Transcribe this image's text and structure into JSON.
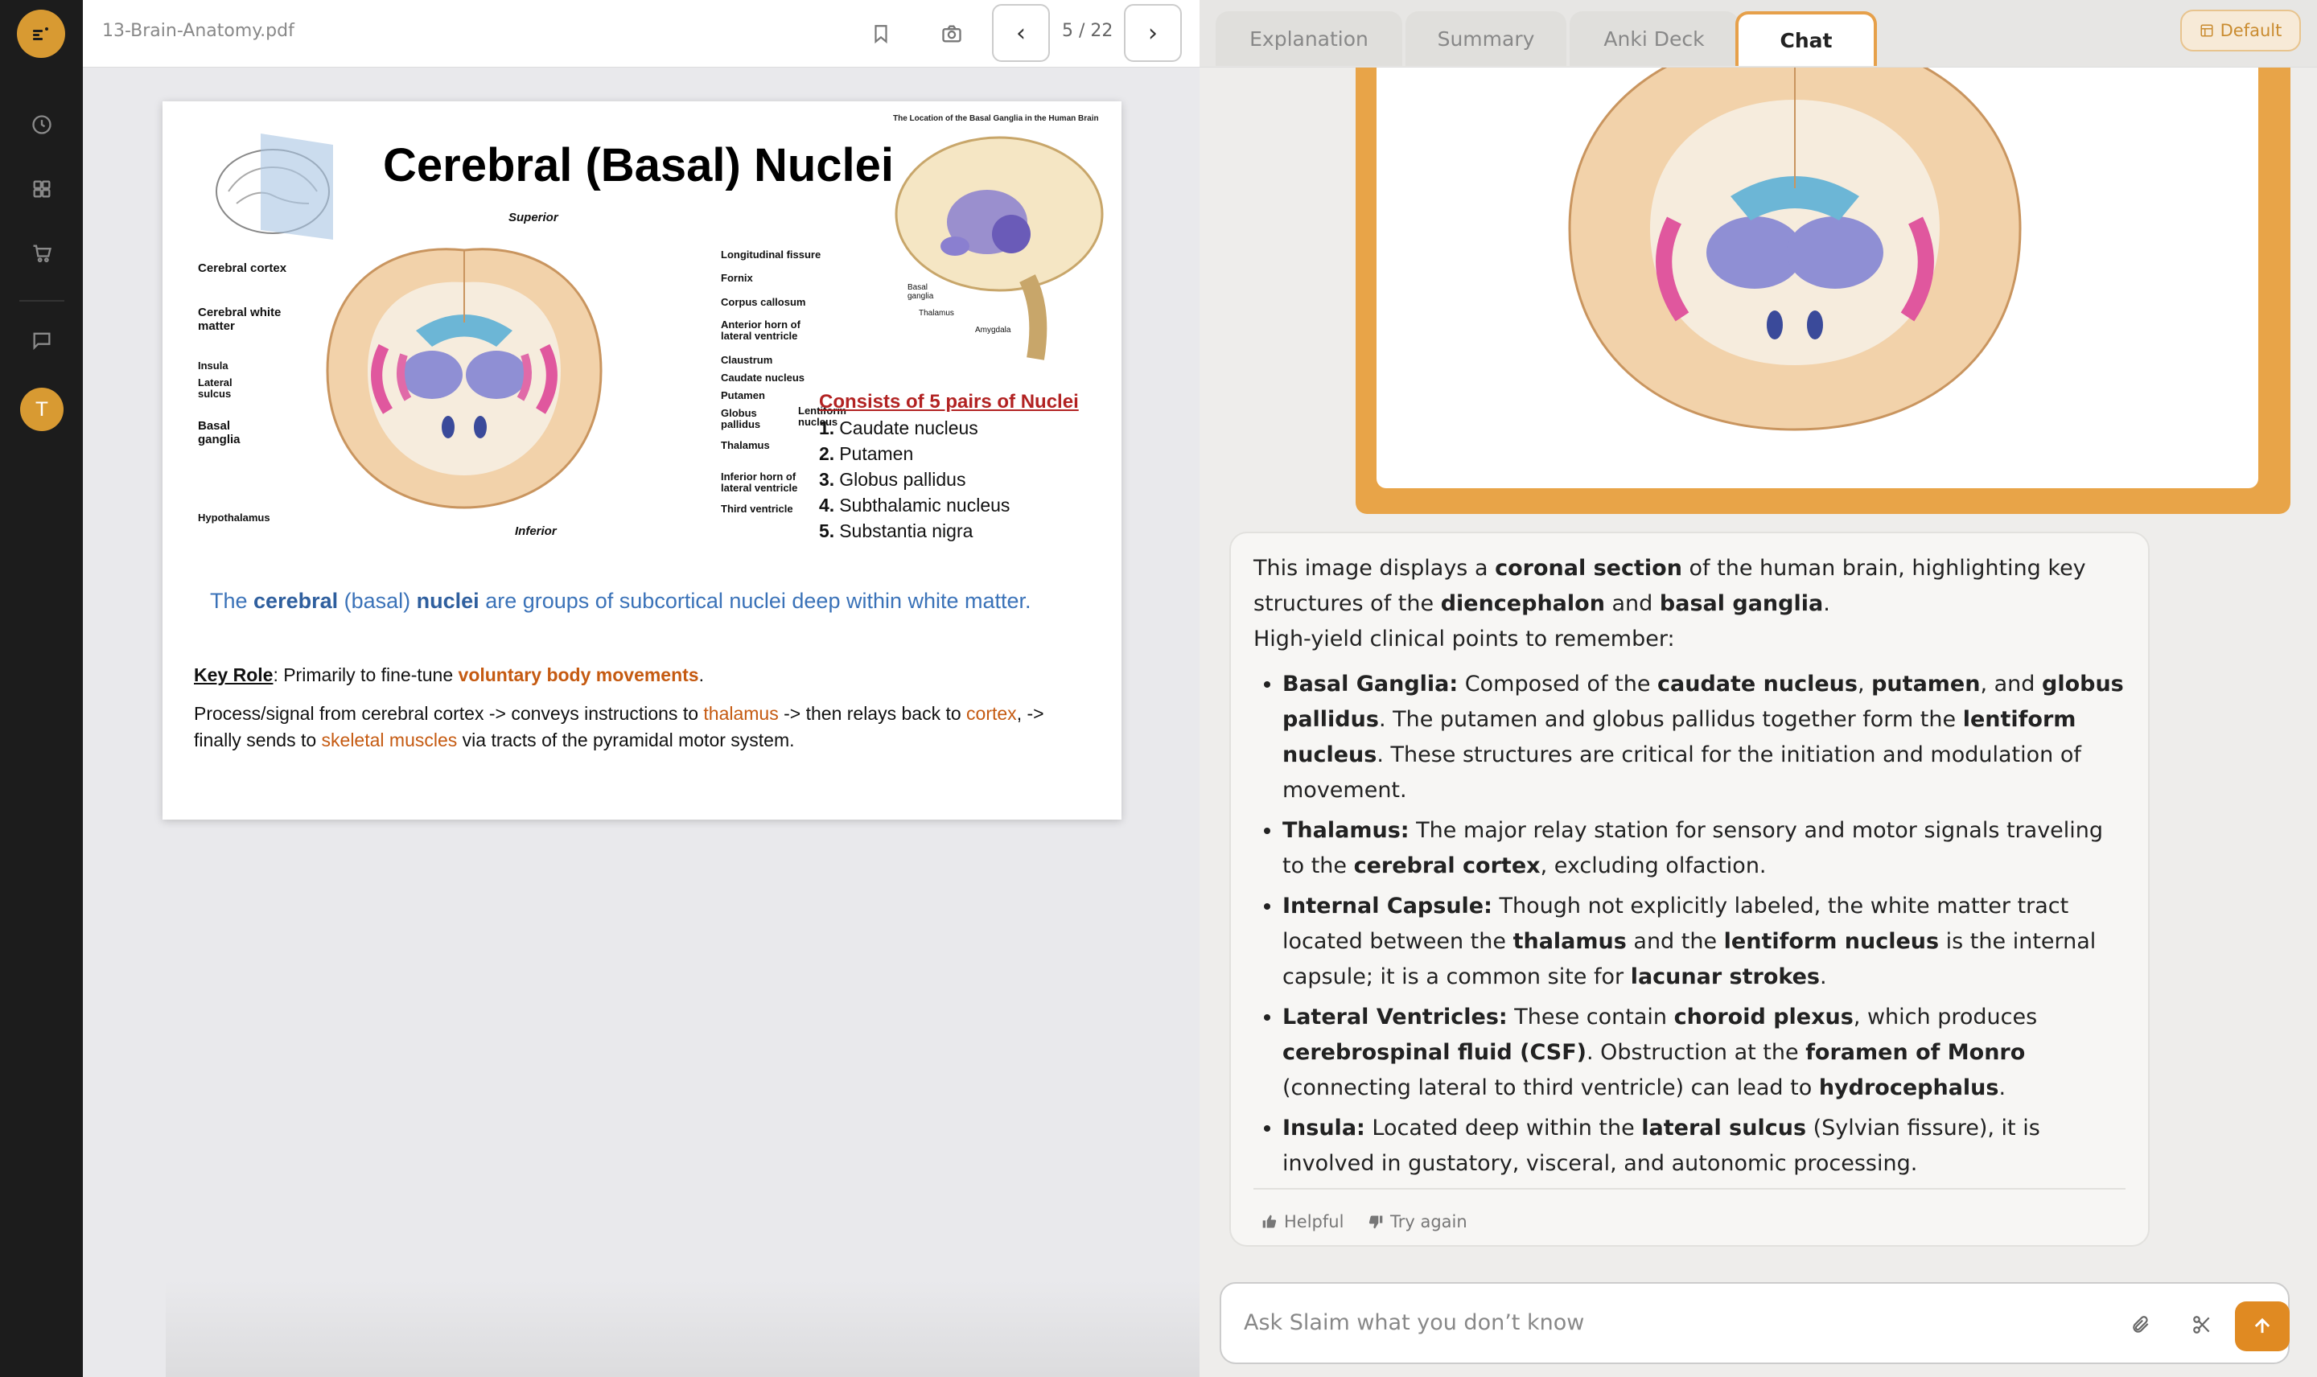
{
  "viewer": {
    "filename": "13-Brain-Anatomy.pdf",
    "page_indicator": "5 / 22"
  },
  "sidebar": {
    "avatar_initial": "T"
  },
  "slide": {
    "title": "Cerebral (Basal) Nuclei",
    "location_caption": "The Location of the Basal Ganglia in the Human Brain",
    "labels": {
      "superior": "Superior",
      "inferior": "Inferior",
      "cerebral_cortex": "Cerebral cortex",
      "cerebral_white_matter": "Cerebral white matter",
      "insula": "Insula",
      "lateral_sulcus": "Lateral sulcus",
      "basal_ganglia": "Basal ganglia",
      "hypothalamus": "Hypothalamus",
      "longitudinal_fissure": "Longitudinal fissure",
      "fornix": "Fornix",
      "corpus_callosum": "Corpus callosum",
      "anterior_horn": "Anterior horn of lateral ventricle",
      "claustrum": "Claustrum",
      "caudate_nucleus": "Caudate nucleus",
      "putamen": "Putamen",
      "globus_pallidus": "Globus pallidus",
      "lentiform_nucleus": "Lentiform nucleus",
      "thalamus": "Thalamus",
      "inferior_horn": "Inferior horn of lateral ventricle",
      "third_ventricle": "Third ventricle",
      "small_basal_ganglia": "Basal ganglia",
      "small_thalamus": "Thalamus",
      "small_amygdala": "Amygdala"
    },
    "consists_title": "Consists of 5 pairs of Nuclei",
    "nuclei": [
      {
        "num": "1.",
        "name": "Caudate nucleus"
      },
      {
        "num": "2.",
        "name": "Putamen"
      },
      {
        "num": "3.",
        "name": "Globus pallidus"
      },
      {
        "num": "4.",
        "name": "Subthalamic nucleus"
      },
      {
        "num": "5.",
        "name": "Substantia nigra"
      }
    ],
    "definition": {
      "pre": "The ",
      "b1": "cerebral",
      "mid1": " (basal) ",
      "b2": "nuclei",
      "post": " are groups of subcortical nuclei deep within white matter."
    },
    "key_role": {
      "label": "Key Role",
      "text": ": Primarily to fine-tune ",
      "highlight": "voluntary body movements",
      "end": "."
    },
    "process": {
      "t1": "Process/signal from cerebral cortex -> conveys instructions to ",
      "h1": "thalamus",
      "t2": " -> then relays back to ",
      "h2": "cortex",
      "t3": ", -> finally sends to ",
      "h3": "skeletal muscles",
      "t4": " via tracts of the pyramidal motor system."
    }
  },
  "tabs": [
    "Explanation",
    "Summary",
    "Anki Deck",
    "Chat"
  ],
  "default_label": "Default",
  "message": {
    "intro_pre": "This image displays a ",
    "intro_b1": "coronal section",
    "intro_mid": " of the human brain, highlighting key structures of the ",
    "intro_b2": "diencephalon",
    "intro_and": " and ",
    "intro_b3": "basal ganglia",
    "intro_end": ".",
    "subhead": "High-yield clinical points to remember:",
    "bullets": {
      "b1_title": "Basal Ganglia:",
      "b1_t1": " Composed of the ",
      "b1_s1": "caudate nucleus",
      "b1_t2": ", ",
      "b1_s2": "putamen",
      "b1_t3": ", and ",
      "b1_s3": "globus pallidus",
      "b1_t4": ". The putamen and globus pallidus together form the ",
      "b1_s4": "lentiform nucleus",
      "b1_t5": ". These structures are critical for the initiation and modulation of movement.",
      "b2_title": "Thalamus:",
      "b2_t1": " The major relay station for sensory and motor signals traveling to the ",
      "b2_s1": "cerebral cortex",
      "b2_t2": ", excluding olfaction.",
      "b3_title": "Internal Capsule:",
      "b3_t1": " Though not explicitly labeled, the white matter tract located between the ",
      "b3_s1": "thalamus",
      "b3_t2": " and the ",
      "b3_s2": "lentiform nucleus",
      "b3_t3": " is the internal capsule; it is a common site for ",
      "b3_s3": "lacunar strokes",
      "b3_t4": ".",
      "b4_title": "Lateral Ventricles:",
      "b4_t1": " These contain ",
      "b4_s1": "choroid plexus",
      "b4_t2": ", which produces ",
      "b4_s2": "cerebrospinal fluid (CSF)",
      "b4_t3": ". Obstruction at the ",
      "b4_s3": "foramen of Monro",
      "b4_t4": " (connecting lateral to third ventricle) can lead to ",
      "b4_s4": "hydrocephalus",
      "b4_t5": ".",
      "b5_title": "Insula:",
      "b5_t1": " Located deep within the ",
      "b5_s1": "lateral sulcus",
      "b5_t2": " (Sylvian fissure), it is involved in gustatory, visceral, and autonomic processing."
    },
    "helpful": "Helpful",
    "try_again": "Try again"
  },
  "input": {
    "placeholder": "Ask Slaim what you don’t know"
  },
  "colors": {
    "accent": "#e08a22",
    "sidebar_bg": "#1c1c1c",
    "slide_blue": "#3a72b8",
    "slide_orange": "#c55a11",
    "slide_red": "#b22222"
  }
}
